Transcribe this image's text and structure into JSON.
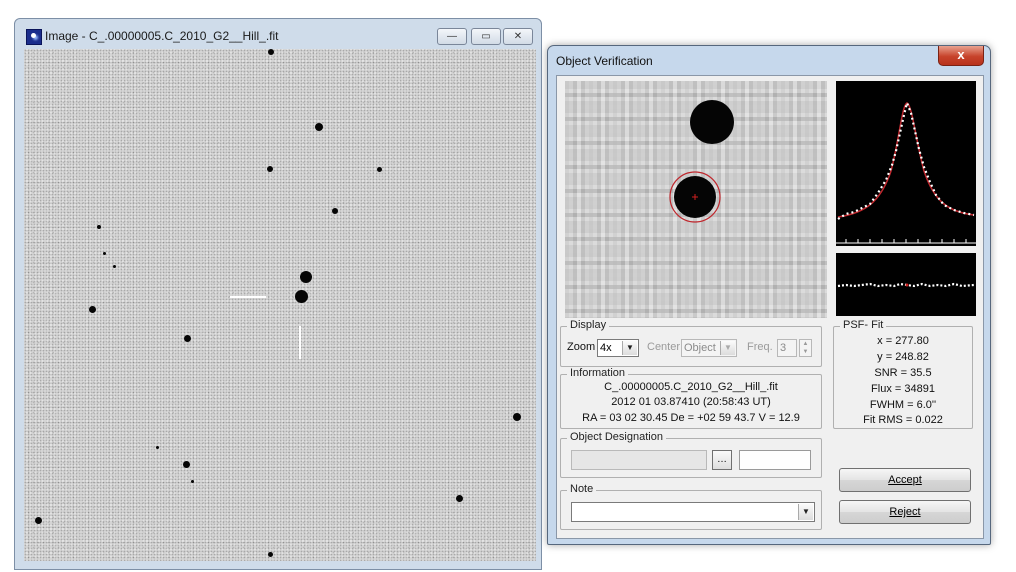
{
  "image_window": {
    "title": "Image - C_.00000005.C_2010_G2__Hill_.fit",
    "minimize_glyph": "—",
    "maximize_glyph": "▭",
    "close_glyph": "✕",
    "icon": "app-icon"
  },
  "dialog": {
    "title": "Object Verification",
    "close_glyph": "x",
    "display": {
      "group_label": "Display",
      "zoom_label": "Zoom",
      "zoom_value": "4x",
      "center_label": "Center",
      "center_value": "Object",
      "freq_label": "Freq.",
      "freq_value": "3"
    },
    "information": {
      "group_label": "Information",
      "filename": "C_.00000005.C_2010_G2__Hill_.fit",
      "date": "2012 01 03.87410 (20:58:43 UT)",
      "coords": "RA = 03 02 30.45   De = +02 59 43.7   V = 12.9"
    },
    "psf_fit": {
      "group_label": "PSF- Fit",
      "x": "x = 277.80",
      "y": "y = 248.82",
      "snr": "SNR = 35.5",
      "flux": "Flux = 34891",
      "fwhm": "FWHM = 6.0''",
      "fit_rms": "Fit RMS = 0.022"
    },
    "object_designation": {
      "group_label": "Object Designation",
      "browse_glyph": "…"
    },
    "note": {
      "group_label": "Note"
    },
    "buttons": {
      "accept": "Accept",
      "reject": "Reject"
    },
    "icons": [
      "dropdown-arrow-icon",
      "browse-icon",
      "spin-up-icon",
      "spin-down-icon"
    ]
  }
}
